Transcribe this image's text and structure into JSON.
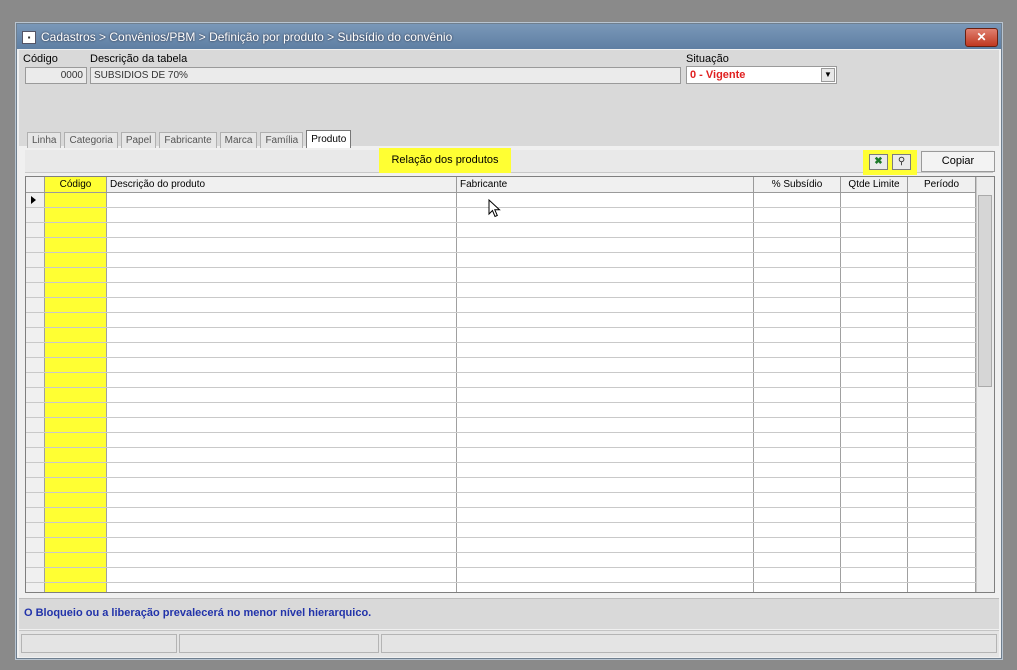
{
  "window": {
    "title": "Cadastros > Convênios/PBM > Definição por produto > Subsídio do convênio",
    "close_label": "✕"
  },
  "header": {
    "codigo_label": "Código",
    "codigo_value": "0000",
    "descricao_label": "Descrição da tabela",
    "descricao_value": "SUBSIDIOS DE 70%",
    "situacao_label": "Situação",
    "situacao_value": "0 - Vigente"
  },
  "tabs": [
    {
      "label": "Linha"
    },
    {
      "label": "Categoria"
    },
    {
      "label": "Papel"
    },
    {
      "label": "Fabricante"
    },
    {
      "label": "Marca"
    },
    {
      "label": "Família"
    },
    {
      "label": "Produto"
    }
  ],
  "toolbar": {
    "relation_label": "Relação dos produtos",
    "copy_label": "Copiar",
    "excel_icon": "excel-export-icon",
    "search_icon": "search-icon"
  },
  "grid": {
    "columns": [
      "Código",
      "Descrição do produto",
      "Fabricante",
      "% Subsídio",
      "Qtde Limite",
      "Período"
    ]
  },
  "info": {
    "message": "O Bloqueio ou a liberação prevalecerá no menor nível hierarquico."
  },
  "colors": {
    "highlight": "#ffff33",
    "status_red": "#e02020",
    "info_blue": "#2233aa"
  }
}
